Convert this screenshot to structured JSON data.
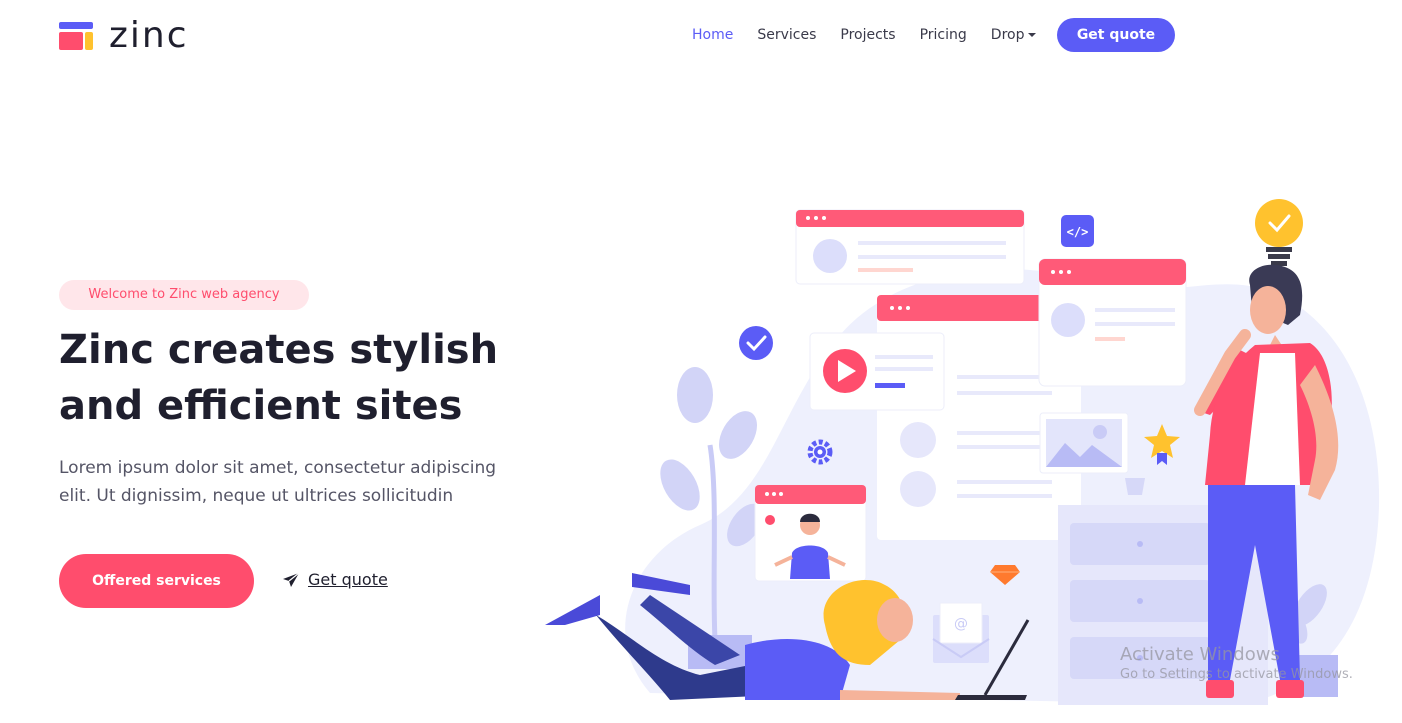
{
  "brand": {
    "name": "zinc"
  },
  "nav": {
    "items": [
      {
        "label": "Home",
        "active": true
      },
      {
        "label": "Services"
      },
      {
        "label": "Projects"
      },
      {
        "label": "Pricing"
      },
      {
        "label": "Drop",
        "has_dropdown": true
      }
    ],
    "cta": "Get quote"
  },
  "hero": {
    "badge": "Welcome to Zinc web agency",
    "title_line1": "Zinc creates stylish",
    "title_line2": "and efficient sites",
    "subtitle": "Lorem ipsum dolor sit amet, consectetur adipiscing elit. Ut dignissim, neque ut ultrices sollicitudin",
    "primary_button": "Offered services",
    "secondary_link": "Get quote"
  },
  "illustration": {
    "code_tag": "</>"
  },
  "watermark": {
    "line1": "Activate Windows",
    "line2": "Go to Settings to activate Windows."
  },
  "colors": {
    "primary": "#5b5cf6",
    "accent": "#ff4d6d",
    "yellow": "#ffc22e",
    "badge_bg": "#ffe6ea"
  }
}
